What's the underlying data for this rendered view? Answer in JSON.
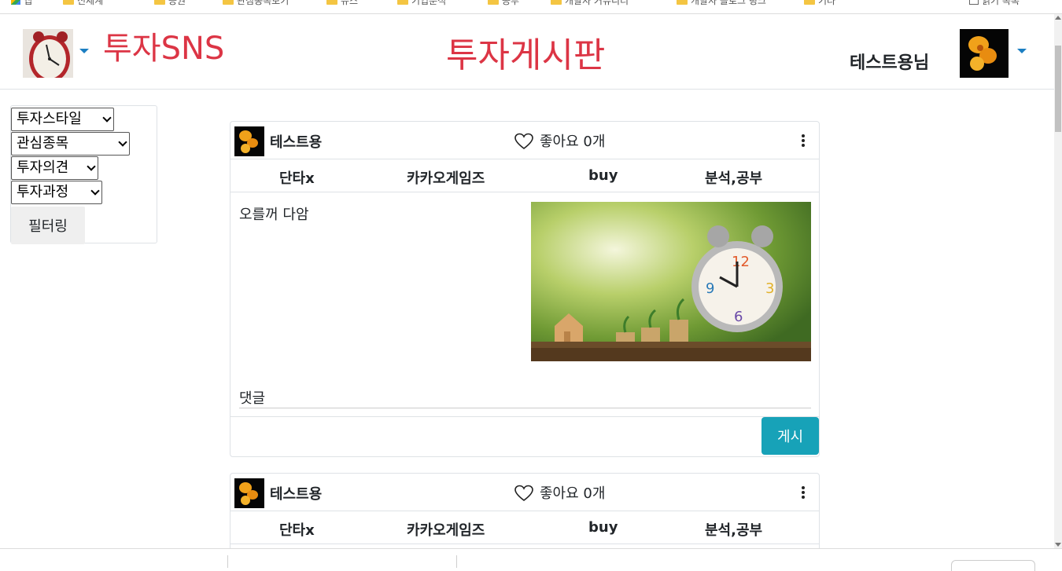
{
  "browser": {
    "bookmarks": [
      "앱",
      "신세계",
      "증권",
      "관심종목보기",
      "뉴스",
      "기업분석",
      "공부",
      "개발자 커뮤니티",
      "개발자 블로그 링크",
      "기타",
      "읽기 목록"
    ]
  },
  "header": {
    "brand": "투자SNS",
    "page_title": "투자게시판",
    "user_name": "테스트용님"
  },
  "filters": {
    "style": "투자스타일",
    "stock": "관심종목",
    "opinion": "투자의견",
    "process": "투자과정",
    "button": "필터링"
  },
  "posts": [
    {
      "author": "테스트용",
      "likes": "좋아요 0개",
      "tags": [
        "단타x",
        "카카오게임즈",
        "buy",
        "분석,공부"
      ],
      "content": "오를꺼 다암",
      "comment_label": "댓글",
      "post_button": "게시"
    },
    {
      "author": "테스트용",
      "likes": "좋아요 0개",
      "tags": [
        "단타x",
        "카카오게임즈",
        "buy",
        "분석,공부"
      ]
    }
  ],
  "colors": {
    "brand": "#dc3545",
    "post_button": "#17a2b8",
    "caret": "#1b7ec2"
  }
}
